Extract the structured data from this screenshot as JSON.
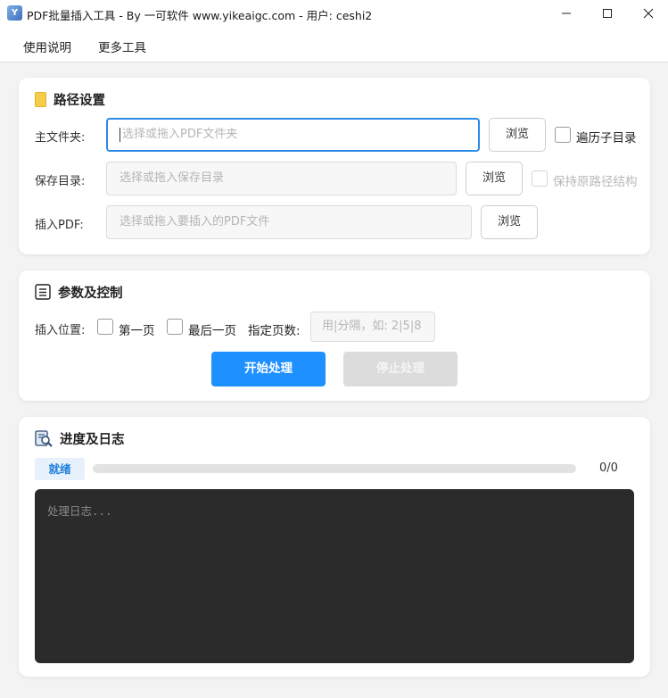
{
  "window": {
    "icon_text": "Y",
    "title": "PDF批量插入工具 - By 一可软件 www.yikeaigc.com - 用户: ceshi2",
    "controls": [
      "minimize-icon",
      "maximize-icon",
      "close-icon"
    ]
  },
  "menu": {
    "help": "使用说明",
    "more_tools": "更多工具"
  },
  "path_settings": {
    "title": "路径设置",
    "icon": "folder-icon",
    "main_folder": {
      "label": "主文件夹:",
      "placeholder": "选择或拖入PDF文件夹",
      "browse": "浏览",
      "option": "遍历子目录",
      "option_checked": false
    },
    "save_dir": {
      "label": "保存目录:",
      "placeholder": "选择或拖入保存目录",
      "browse": "浏览",
      "option": "保持原路径结构",
      "option_checked": false,
      "option_disabled": true
    },
    "insert_pdf": {
      "label": "插入PDF:",
      "placeholder": "选择或拖入要插入的PDF文件",
      "browse": "浏览"
    }
  },
  "params": {
    "title": "参数及控制",
    "icon": "list-icon",
    "position_label": "插入位置:",
    "first_page": "第一页",
    "last_page": "最后一页",
    "specified_label": "指定页数:",
    "specified_placeholder": "用|分隔，如: 2|5|8",
    "start": "开始处理",
    "stop": "停止处理"
  },
  "progress": {
    "title": "进度及日志",
    "icon": "log-search-icon",
    "status": "就绪",
    "count": "0/0",
    "fraction": 0,
    "log_placeholder": "处理日志..."
  },
  "colors": {
    "accent": "#1e90ff",
    "log_bg": "#2b2b2b"
  }
}
